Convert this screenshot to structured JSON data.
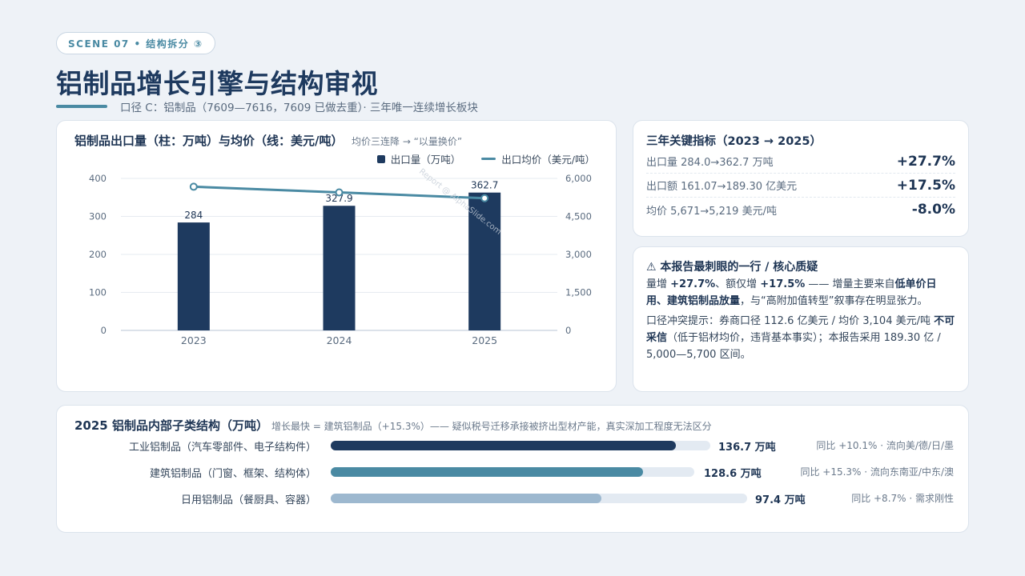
{
  "scene_tag": "SCENE 07 • 结构拆分 ③",
  "page_title": "铝制品增长引擎与结构审视",
  "subtitle": "口径 C：铝制品（7609—7616，7609 已做去重）· 三年唯一连续增长板块",
  "chart_card": {
    "title": "铝制品出口量（柱：万吨）与均价（线：美元/吨）",
    "note": "均价三连降 → “以量换价”",
    "watermark": "Report @ AlphaSlide.com"
  },
  "chart_data": {
    "type": "bar",
    "categories": [
      "2023",
      "2024",
      "2025"
    ],
    "series": [
      {
        "name": "出口量（万吨）",
        "type": "bar",
        "axis": "left",
        "values": [
          284,
          327.9,
          362.7
        ],
        "labels": [
          "284",
          "327.9",
          "362.7"
        ],
        "color": "#1e3a5f"
      },
      {
        "name": "出口均价（美元/吨）",
        "type": "line",
        "axis": "right",
        "values": [
          5671,
          5446,
          5219
        ],
        "color": "#4a8aa3"
      }
    ],
    "ylim_left": [
      0,
      400
    ],
    "yticks_left": [
      "0",
      "100",
      "200",
      "300",
      "400"
    ],
    "ylim_right": [
      0,
      6000
    ],
    "yticks_right": [
      "0",
      "1,500",
      "3,000",
      "4,500",
      "6,000"
    ],
    "grid": true,
    "legend": "top-right"
  },
  "kpi_card": {
    "title": "三年关键指标（2023 → 2025）",
    "rows": [
      {
        "label": "出口量 284.0→362.7 万吨",
        "value": "+27.7%"
      },
      {
        "label": "出口额 161.07→189.30 亿美元",
        "value": "+17.5%"
      },
      {
        "label": "均价 5,671→5,219 美元/吨",
        "value": "-8.0%"
      }
    ]
  },
  "question_card": {
    "title": "⚠ 本报告最刺眼的一行 / 核心质疑",
    "p1": {
      "a": "量增 ",
      "b": "+27.7%",
      "c": "、额仅增 ",
      "d": "+17.5%",
      "e": " —— 增量主要来自",
      "f": "低单价日用、建筑铝制品放量",
      "g": "，与“高附加值转型”叙事存在明显张力。"
    },
    "p2": {
      "a": "口径冲突提示：券商口径 112.6 亿美元 / 均价 3,104 美元/吨 ",
      "b": "不可采信",
      "c": "（低于铝材均价，违背基本事实）；本报告采用 189.30 亿 / 5,000—5,700 区间。"
    }
  },
  "struct_card": {
    "title": "2025 铝制品内部子类结构（万吨）",
    "note": "增长最快 = 建筑铝制品（+15.3%）—— 疑似税号迁移承接被挤出型材产能，真实深加工程度无法区分",
    "rows": [
      {
        "label": "工业铝制品（汽车零部件、电子结构件）",
        "value": "136.7 万吨",
        "amount": 136.7,
        "note": "同比 +10.1% · 流向美/德/日/墨",
        "color": "#1e3a5f"
      },
      {
        "label": "建筑铝制品（门窗、框架、结构体）",
        "value": "128.6 万吨",
        "amount": 128.6,
        "note": "同比 +15.3% · 流向东南亚/中东/澳",
        "color": "#4a8aa3"
      },
      {
        "label": "日用铝制品（餐厨具、容器）",
        "value": "97.4 万吨",
        "amount": 97.4,
        "note": "同比 +8.7% · 需求刚性",
        "color": "#9db8cf"
      }
    ]
  }
}
